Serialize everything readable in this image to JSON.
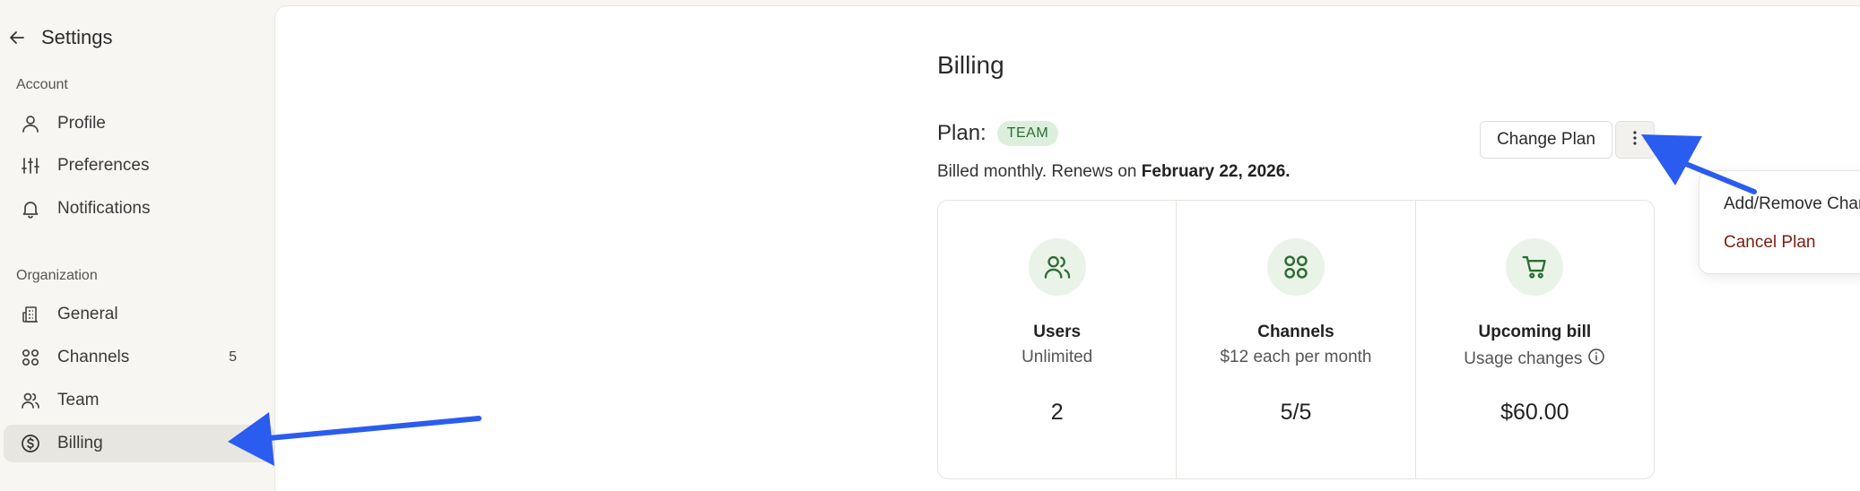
{
  "sidebar": {
    "title": "Settings",
    "account_label": "Account",
    "organization_label": "Organization",
    "items": [
      {
        "label": "Profile",
        "icon": "user-icon"
      },
      {
        "label": "Preferences",
        "icon": "sliders-icon"
      },
      {
        "label": "Notifications",
        "icon": "bell-icon"
      },
      {
        "label": "General",
        "icon": "building-icon"
      },
      {
        "label": "Channels",
        "icon": "grid-icon",
        "count": "5"
      },
      {
        "label": "Team",
        "icon": "users-icon"
      },
      {
        "label": "Billing",
        "icon": "dollar-circle-icon",
        "active": true
      }
    ]
  },
  "billing": {
    "title": "Billing",
    "plan_label": "Plan:",
    "plan_badge": "TEAM",
    "billed_prefix": "Billed monthly. Renews on ",
    "renew_date": "February 22, 2026.",
    "change_plan": "Change Plan",
    "menu": {
      "add_remove": "Add/Remove Channels",
      "cancel": "Cancel Plan"
    },
    "cards": [
      {
        "name": "Users",
        "sub": "Unlimited",
        "value": "2",
        "icon": "users-icon"
      },
      {
        "name": "Channels",
        "sub": "$12 each per month",
        "value": "5/5",
        "icon": "grid-icon"
      },
      {
        "name": "Upcoming bill",
        "sub": "Usage changes",
        "value": "$60.00",
        "icon": "cart-icon"
      }
    ]
  },
  "colors": {
    "accent_green": "#2f6b36",
    "badge_bg": "#dcefdc",
    "danger": "#7a1f12",
    "arrow": "#2a5cf0"
  }
}
